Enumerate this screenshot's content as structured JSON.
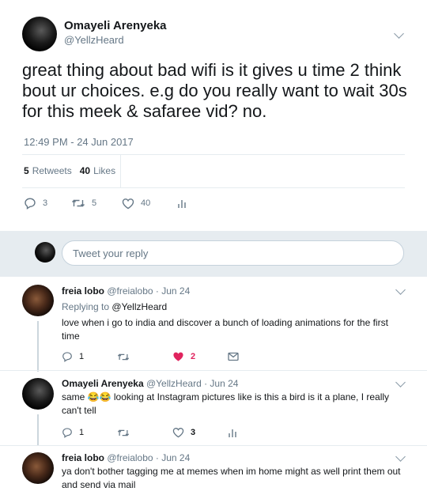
{
  "main_tweet": {
    "author_name": "Omayeli Arenyeka",
    "author_handle": "@YellzHeard",
    "text": "great thing about bad wifi is it gives u time 2 think bout ur choices. e.g do you really want to wait 30s for this meek & safaree vid? no.",
    "timestamp": "12:49 PM - 24 Jun 2017",
    "retweets_count": "5",
    "retweets_label": "Retweets",
    "likes_count": "40",
    "likes_label": "Likes",
    "reply_count": "3",
    "retweet_count": "5",
    "like_count": "40"
  },
  "reply_box": {
    "placeholder": "Tweet your reply"
  },
  "replies": [
    {
      "name": "freia lobo",
      "handle": "@freialobo",
      "date": "· Jun 24",
      "replying_label": "Replying to",
      "replying_to": "@YellzHeard",
      "text": "love when i go to india and discover a bunch of loading animations for the first time",
      "reply_count": "1",
      "like_count": "2"
    },
    {
      "name": "Omayeli Arenyeka",
      "handle": "@YellzHeard",
      "date": "· Jun 24",
      "text": "same 😂😂 looking at Instagram pictures like is this a bird is it a plane, I really can't tell",
      "reply_count": "1",
      "like_count": "3"
    },
    {
      "name": "freia lobo",
      "handle": "@freialobo",
      "date": "· Jun 24",
      "text": "ya don't bother tagging me at memes when im home might as well print them out and send via mail"
    }
  ],
  "colors": {
    "accent": "#1da1f2",
    "like_active": "#e0245e",
    "muted": "#657786"
  }
}
